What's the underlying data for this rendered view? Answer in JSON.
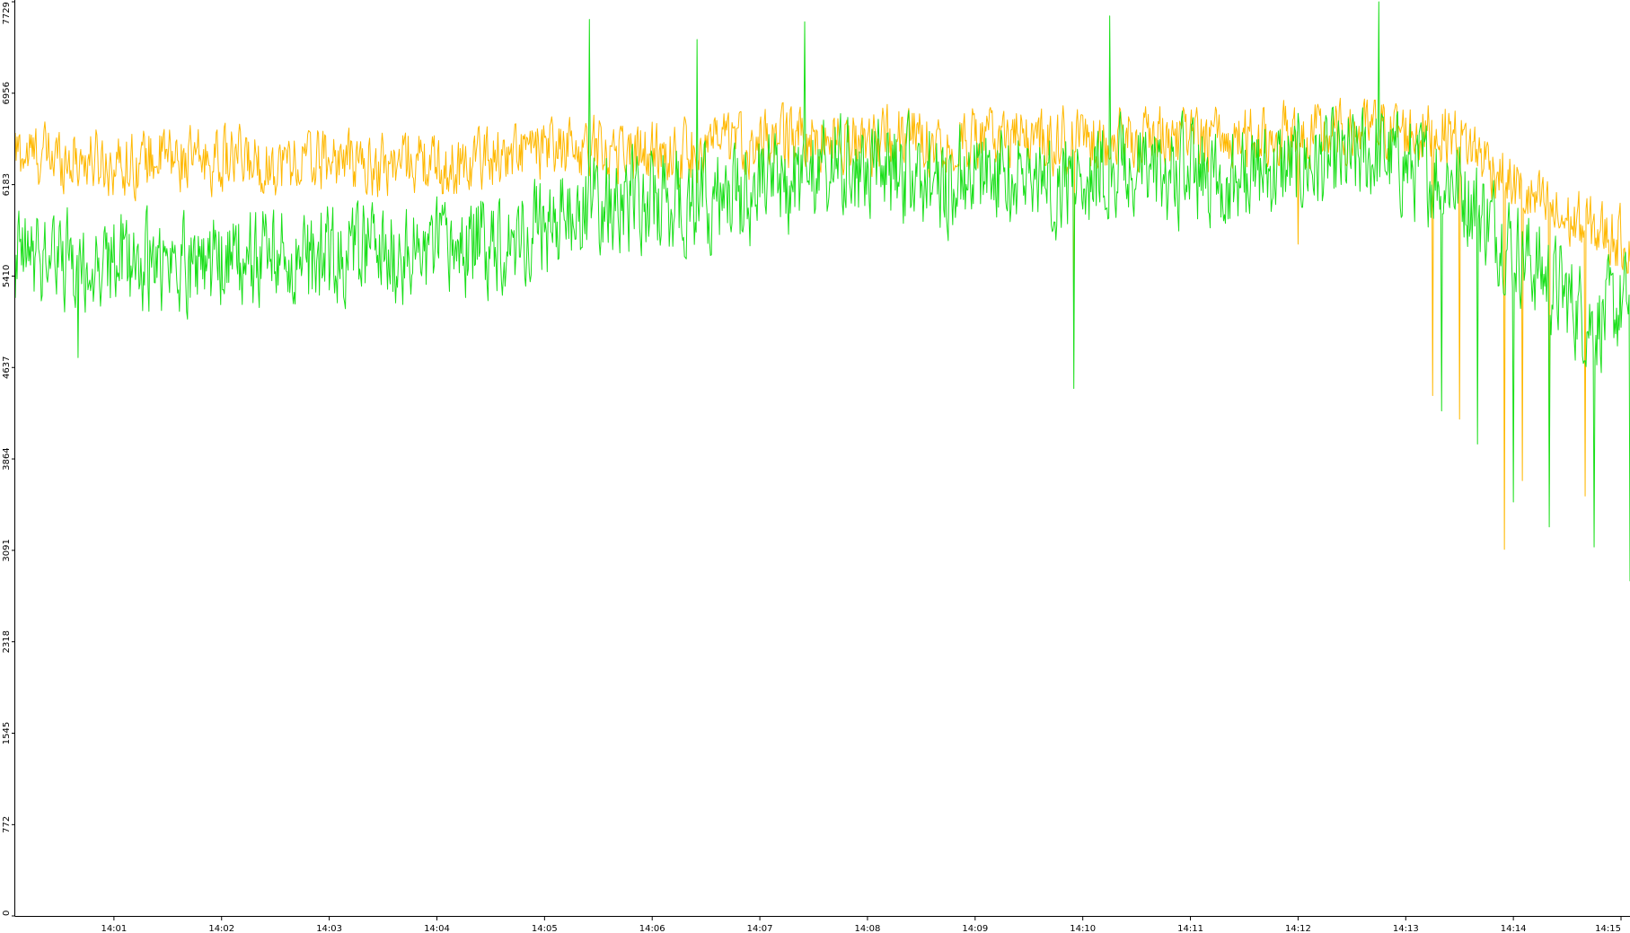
{
  "chart_data": {
    "type": "line",
    "title": "",
    "xlabel": "",
    "ylabel": "",
    "grid": false,
    "legend": "none",
    "x_range": [
      "14:00:05",
      "14:15:05"
    ],
    "ylim": [
      0,
      7729
    ],
    "y_ticks": [
      {
        "value": 0,
        "label": "0"
      },
      {
        "value": 772,
        "label": "772"
      },
      {
        "value": 1545,
        "label": "1545"
      },
      {
        "value": 2318,
        "label": "2318"
      },
      {
        "value": 3091,
        "label": "3091"
      },
      {
        "value": 3864,
        "label": "3864"
      },
      {
        "value": 4637,
        "label": "4637"
      },
      {
        "value": 5410,
        "label": "5410"
      },
      {
        "value": 6183,
        "label": "6183"
      },
      {
        "value": 6956,
        "label": "6956"
      },
      {
        "value": 7729,
        "label": "7729"
      }
    ],
    "x_ticks": [
      {
        "value": "14:01:00",
        "label": "14:01"
      },
      {
        "value": "14:02:00",
        "label": "14:02"
      },
      {
        "value": "14:03:00",
        "label": "14:03"
      },
      {
        "value": "14:04:00",
        "label": "14:04"
      },
      {
        "value": "14:05:00",
        "label": "14:05"
      },
      {
        "value": "14:06:00",
        "label": "14:06"
      },
      {
        "value": "14:07:00",
        "label": "14:07"
      },
      {
        "value": "14:08:00",
        "label": "14:08"
      },
      {
        "value": "14:09:00",
        "label": "14:09"
      },
      {
        "value": "14:10:00",
        "label": "14:10"
      },
      {
        "value": "14:11:00",
        "label": "14:11"
      },
      {
        "value": "14:12:00",
        "label": "14:12"
      },
      {
        "value": "14:13:00",
        "label": "14:13"
      },
      {
        "value": "14:14:00",
        "label": "14:14"
      },
      {
        "value": "14:15:00",
        "label": "14:15"
      }
    ],
    "series": [
      {
        "color": "#ffb800",
        "x": [
          "14:00:05",
          "14:00:25",
          "14:00:45",
          "14:01:05",
          "14:01:25",
          "14:01:45",
          "14:02:05",
          "14:02:25",
          "14:02:45",
          "14:03:05",
          "14:03:25",
          "14:03:45",
          "14:04:05",
          "14:04:25",
          "14:04:45",
          "14:05:05",
          "14:05:25",
          "14:05:45",
          "14:06:05",
          "14:06:25",
          "14:06:45",
          "14:07:05",
          "14:07:25",
          "14:07:45",
          "14:08:05",
          "14:08:25",
          "14:08:45",
          "14:09:05",
          "14:09:25",
          "14:09:45",
          "14:10:05",
          "14:10:25",
          "14:10:45",
          "14:11:05",
          "14:11:25",
          "14:11:45",
          "14:12:05",
          "14:12:25",
          "14:12:45",
          "14:13:05",
          "14:13:25",
          "14:13:45",
          "14:14:05",
          "14:14:25",
          "14:14:45",
          "14:15:05"
        ],
        "y": [
          6450,
          6420,
          6400,
          6350,
          6420,
          6380,
          6400,
          6350,
          6380,
          6400,
          6330,
          6400,
          6300,
          6420,
          6450,
          6480,
          6500,
          6470,
          6450,
          6480,
          6520,
          6550,
          6580,
          6560,
          6570,
          6580,
          6560,
          6580,
          6570,
          6560,
          6580,
          6560,
          6580,
          6560,
          6570,
          6600,
          6580,
          6610,
          6650,
          6630,
          6620,
          6400,
          6100,
          5900,
          5800,
          5700
        ],
        "dips": [
          {
            "x": "14:09:55",
            "y": 4880
          },
          {
            "x": "14:12:00",
            "y": 5680
          },
          {
            "x": "14:13:15",
            "y": 4400
          },
          {
            "x": "14:13:30",
            "y": 4200
          },
          {
            "x": "14:13:55",
            "y": 3100
          },
          {
            "x": "14:14:05",
            "y": 3680
          },
          {
            "x": "14:14:20",
            "y": 3650
          },
          {
            "x": "14:14:40",
            "y": 3550
          }
        ]
      },
      {
        "color": "#1adf1a",
        "x": [
          "14:00:05",
          "14:00:25",
          "14:00:45",
          "14:01:05",
          "14:01:25",
          "14:01:45",
          "14:02:05",
          "14:02:25",
          "14:02:45",
          "14:03:05",
          "14:03:25",
          "14:03:45",
          "14:04:05",
          "14:04:25",
          "14:04:45",
          "14:05:05",
          "14:05:25",
          "14:05:45",
          "14:06:05",
          "14:06:25",
          "14:06:45",
          "14:07:05",
          "14:07:25",
          "14:07:45",
          "14:08:05",
          "14:08:25",
          "14:08:45",
          "14:09:05",
          "14:09:25",
          "14:09:45",
          "14:10:05",
          "14:10:25",
          "14:10:45",
          "14:11:05",
          "14:11:25",
          "14:11:45",
          "14:12:05",
          "14:12:25",
          "14:12:45",
          "14:13:05",
          "14:13:25",
          "14:13:45",
          "14:14:05",
          "14:14:25",
          "14:14:45",
          "14:15:05"
        ],
        "y": [
          5500,
          5600,
          5450,
          5550,
          5480,
          5550,
          5500,
          5600,
          5520,
          5550,
          5620,
          5580,
          5600,
          5700,
          5750,
          5850,
          6000,
          6050,
          6000,
          6050,
          6100,
          6150,
          6250,
          6300,
          6280,
          6300,
          6200,
          6300,
          6250,
          6200,
          6300,
          6320,
          6250,
          6300,
          6200,
          6300,
          6350,
          6350,
          6450,
          6300,
          6250,
          5900,
          5600,
          5300,
          5000,
          5200
        ],
        "dips": [
          {
            "x": "14:00:40",
            "y": 4720
          },
          {
            "x": "14:09:55",
            "y": 4460
          },
          {
            "x": "14:13:20",
            "y": 4270
          },
          {
            "x": "14:13:40",
            "y": 3990
          },
          {
            "x": "14:14:00",
            "y": 3500
          },
          {
            "x": "14:14:20",
            "y": 3290
          },
          {
            "x": "14:14:45",
            "y": 3120
          },
          {
            "x": "14:15:05",
            "y": 2830
          }
        ],
        "spikes": [
          {
            "x": "14:05:25",
            "y": 7580
          },
          {
            "x": "14:06:25",
            "y": 7410
          },
          {
            "x": "14:07:25",
            "y": 7560
          },
          {
            "x": "14:10:15",
            "y": 7610
          },
          {
            "x": "14:12:45",
            "y": 7729
          }
        ]
      }
    ]
  }
}
